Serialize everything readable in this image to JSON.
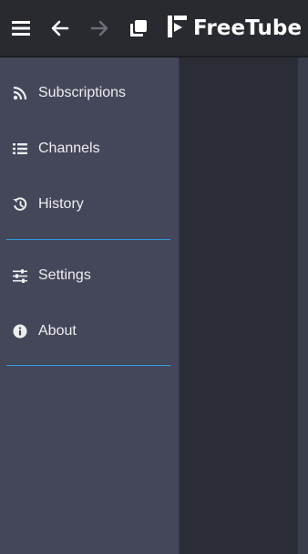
{
  "app": {
    "name": "FreeTube"
  },
  "topbar": {
    "menu_icon": "hamburger-icon",
    "back_icon": "arrow-left-icon",
    "forward_icon": "arrow-right-icon",
    "new_window_icon": "copy-window-icon",
    "logo_text": "FreeTube"
  },
  "sidebar": {
    "items": [
      {
        "label": "Subscriptions",
        "icon": "rss-icon"
      },
      {
        "label": "Channels",
        "icon": "list-icon"
      },
      {
        "label": "History",
        "icon": "history-icon"
      },
      {
        "label": "Settings",
        "icon": "sliders-icon"
      },
      {
        "label": "About",
        "icon": "info-icon"
      }
    ]
  },
  "colors": {
    "topbar_bg": "#282a30",
    "sidebar_bg": "#44475a",
    "content_bg": "#2a2c36",
    "accent_divider": "#2f9ae0",
    "text": "#eeeeee",
    "icon_disabled": "#6b6d78"
  }
}
